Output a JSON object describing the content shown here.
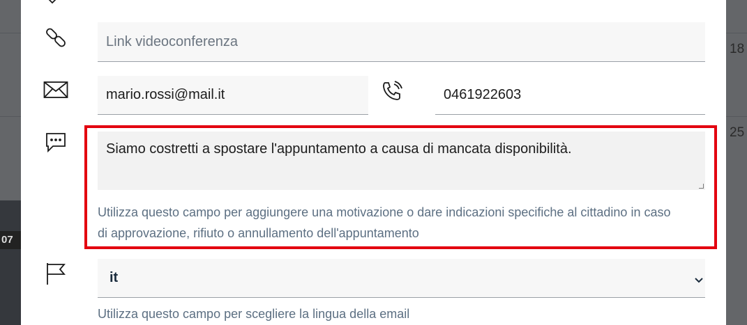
{
  "background": {
    "right_numbers": [
      "18",
      "25"
    ],
    "left_badge": "07"
  },
  "form": {
    "link_field": {
      "placeholder": "Link videoconferenza",
      "value": ""
    },
    "email_field": {
      "value": "mario.rossi@mail.it"
    },
    "phone_field": {
      "value": "0461922603"
    },
    "message_field": {
      "value": "Siamo costretti a spostare l'appuntamento a causa di mancata disponibilità.",
      "help_line1": "Utilizza questo campo per aggiungere una motivazione o dare indicazioni specifiche al cittadino in caso",
      "help_line2": "di approvazione, rifiuto o annullamento dell'appuntamento"
    },
    "language_field": {
      "selected": "it",
      "help": "Utilizza questo campo per scegliere la lingua della email"
    }
  },
  "icons": [
    "chevron-down-icon",
    "link-icon",
    "envelope-icon",
    "phone-icon",
    "chat-icon",
    "flag-icon"
  ],
  "colors": {
    "highlight": "#e3000f",
    "help_text": "#5c6f82"
  }
}
